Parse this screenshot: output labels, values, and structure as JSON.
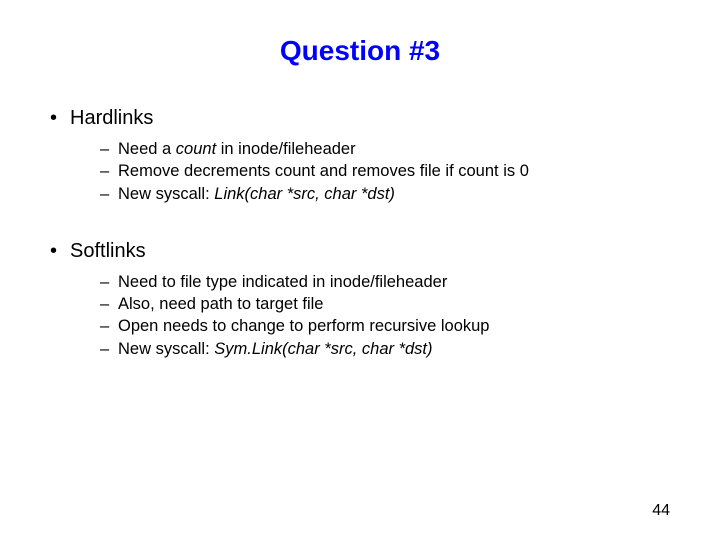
{
  "title": "Question #3",
  "sections": [
    {
      "heading": "Hardlinks",
      "items": [
        {
          "pre": "Need a ",
          "em": "count",
          "post": " in inode/fileheader"
        },
        {
          "pre": "Remove decrements count and removes file if count is 0",
          "em": "",
          "post": ""
        },
        {
          "pre": "New syscall: ",
          "em": "Link(char *src, char *dst)",
          "post": ""
        }
      ]
    },
    {
      "heading": "Softlinks",
      "items": [
        {
          "pre": "Need to file type indicated in inode/fileheader",
          "em": "",
          "post": ""
        },
        {
          "pre": "Also, need path to target file",
          "em": "",
          "post": ""
        },
        {
          "pre": "Open needs to change to perform recursive lookup",
          "em": "",
          "post": ""
        },
        {
          "pre": "New syscall: ",
          "em": "Sym.Link(char *src, char *dst)",
          "post": ""
        }
      ]
    }
  ],
  "pageNumber": "44"
}
